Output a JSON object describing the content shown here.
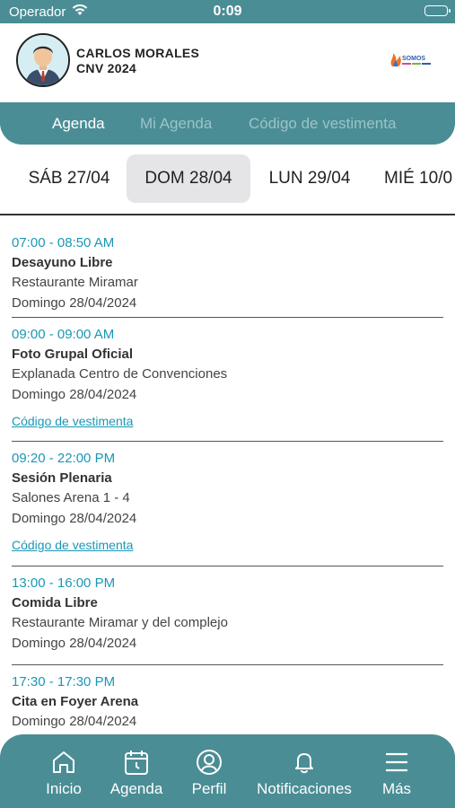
{
  "status": {
    "carrier": "Operador",
    "time": "0:09"
  },
  "header": {
    "name": "CARLOS MORALES",
    "event": "CNV 2024",
    "logo_text": "SOMOS"
  },
  "tabs": [
    {
      "label": "Agenda",
      "active": true
    },
    {
      "label": "Mi Agenda",
      "active": false
    },
    {
      "label": "Código de vestimenta",
      "active": false
    }
  ],
  "dates": [
    "SÁB 27/04",
    "DOM 28/04",
    "LUN 29/04",
    "MIÉ 10/0"
  ],
  "selected_date": "DOM 28/04",
  "events": [
    {
      "time": "07:00 - 08:50 AM",
      "title": "Desayuno Libre",
      "place": "Restaurante Miramar",
      "date": "Domingo  28/04/2024",
      "link": ""
    },
    {
      "time": "09:00 - 09:00 AM",
      "title": "Foto Grupal Oficial",
      "place": "Explanada Centro de Convenciones",
      "date": "Domingo  28/04/2024",
      "link": "Código de vestimenta"
    },
    {
      "time": "09:20 - 22:00 PM",
      "title": "Sesión Plenaria",
      "place": "Salones Arena 1 - 4",
      "date": "Domingo  28/04/2024",
      "link": "Código de vestimenta"
    },
    {
      "time": "13:00 - 16:00 PM",
      "title": "Comida Libre",
      "place": "Restaurante Miramar y del complejo",
      "date": "Domingo  28/04/2024",
      "link": ""
    },
    {
      "time": "17:30 - 17:30 PM",
      "title": "Cita en Foyer Arena",
      "place": "",
      "date": "Domingo  28/04/2024",
      "link": ""
    }
  ],
  "nav": [
    {
      "label": "Inicio",
      "icon": "home-icon"
    },
    {
      "label": "Agenda",
      "icon": "calendar-icon"
    },
    {
      "label": "Perfil",
      "icon": "profile-icon"
    },
    {
      "label": "Notificaciones",
      "icon": "bell-icon"
    },
    {
      "label": "Más",
      "icon": "menu-icon"
    }
  ],
  "colors": {
    "primary": "#4a8d95",
    "accent": "#1a97b5",
    "selected_bg": "#e5e5e7"
  }
}
